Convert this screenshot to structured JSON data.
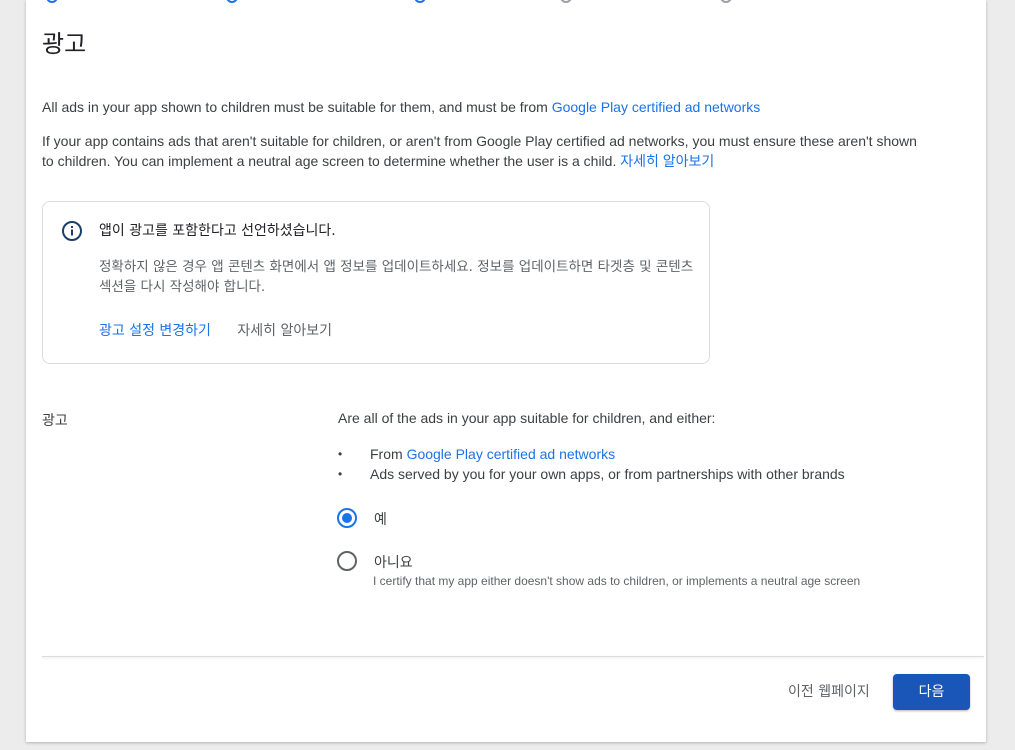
{
  "page": {
    "title": "광고",
    "intro_text": "All ads in your app shown to children must be suitable for them, and must be from ",
    "intro_link": "Google Play certified ad networks",
    "detail_text": "If your app contains ads that aren't suitable for children, or aren't from Google Play certified ad networks, you must ensure these aren't shown to children. You can implement a neutral age screen to determine whether the user is a child. ",
    "detail_link": "자세히 알아보기"
  },
  "notice": {
    "icon": "info-icon",
    "title": "앱이 광고를 포함한다고 선언하셨습니다.",
    "body": "정확하지 않은 경우 앱 콘텐츠 화면에서 앱 정보를 업데이트하세요. 정보를 업데이트하면 타겟층 및 콘텐츠 섹션을 다시 작성해야 합니다.",
    "action_change": "광고 설정 변경하기",
    "action_learn": "자세히 알아보기"
  },
  "ads_section": {
    "label": "광고",
    "question": "Are all of the ads in your app suitable for children, and either:",
    "bullet1_prefix": "From ",
    "bullet1_link": "Google Play certified ad networks",
    "bullet2": "Ads served by you for your own apps, or from partnerships with other brands",
    "options": [
      {
        "label": "예",
        "selected": true
      },
      {
        "label": "아니요",
        "description": "I certify that my app either doesn't show ads to children, or implements a neutral age screen",
        "selected": false
      }
    ]
  },
  "footer": {
    "prev_label": "이전 웹페이지",
    "next_label": "다음"
  },
  "colors": {
    "accent": "#1a73e8",
    "primary_button": "#1a56b8",
    "info_icon": "#1a3f6e"
  }
}
